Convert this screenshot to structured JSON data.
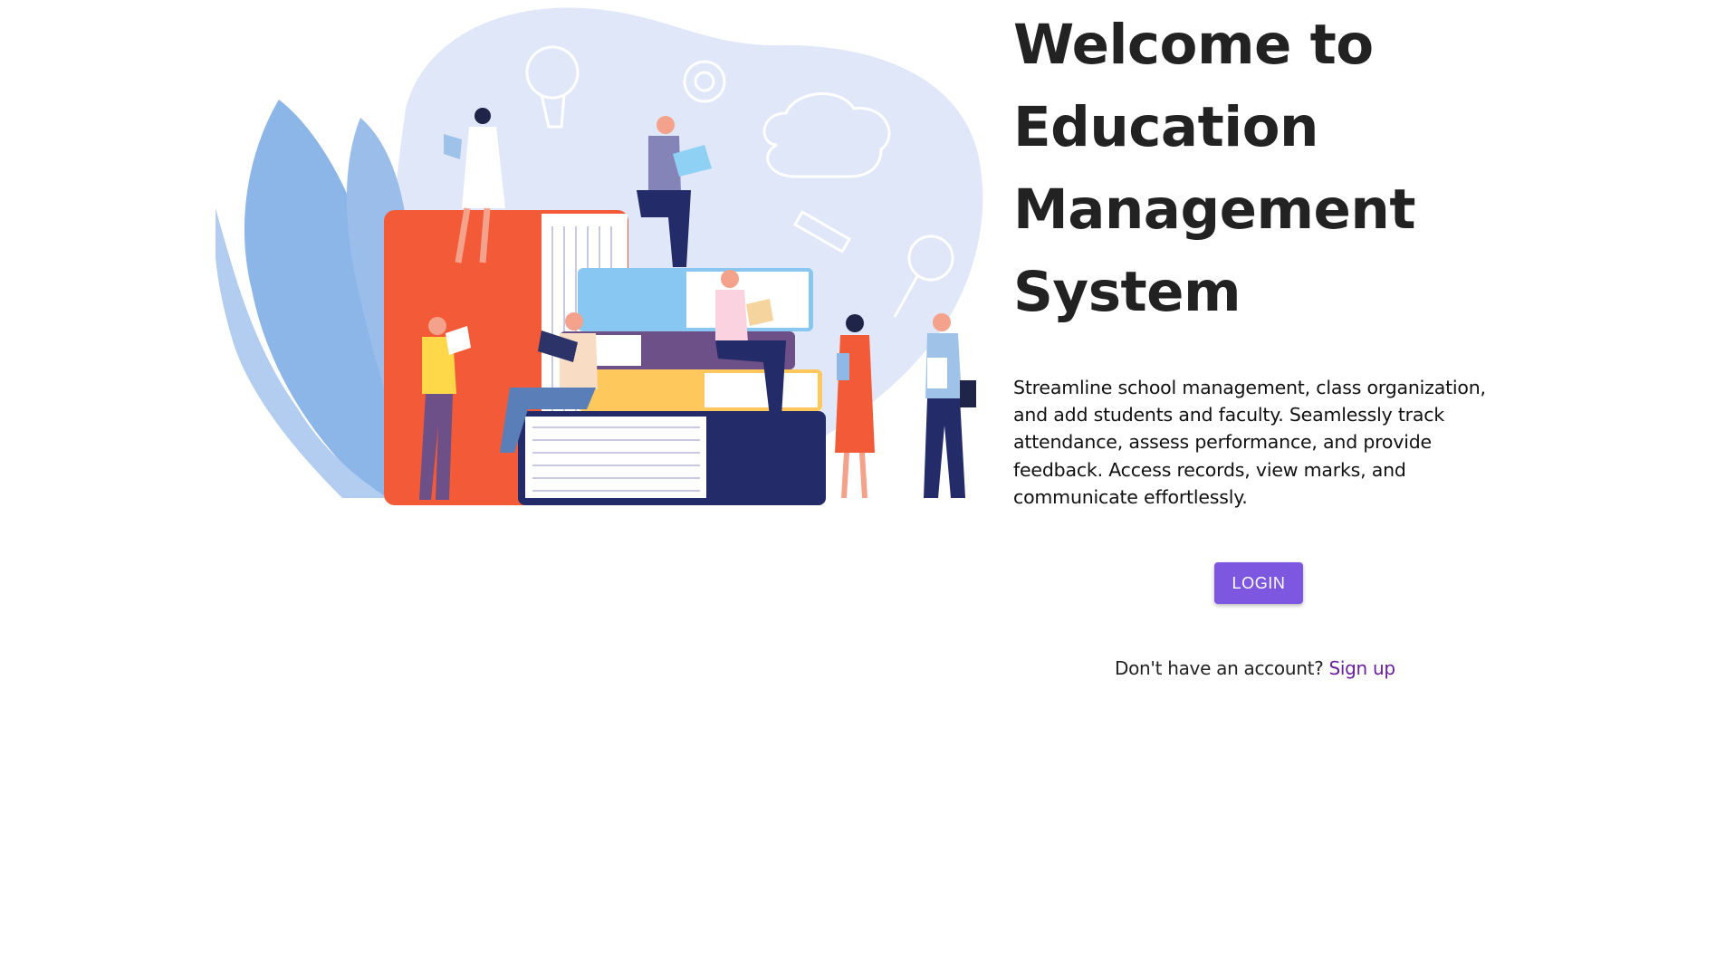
{
  "hero": {
    "title_lines": [
      "Welcome to",
      "Education",
      "Management",
      "System"
    ],
    "description": "Streamline school management, class organization, and add students and faculty. Seamlessly track attendance, assess performance, and provide feedback. Access records, view marks, and communicate effortlessly."
  },
  "actions": {
    "login_label": "LOGIN",
    "signup_prompt": "Don't have an account?",
    "signup_link": "Sign up"
  },
  "colors": {
    "accent": "#7e57e0",
    "link": "#6a1ea0",
    "blob": "#dfe7f8"
  }
}
